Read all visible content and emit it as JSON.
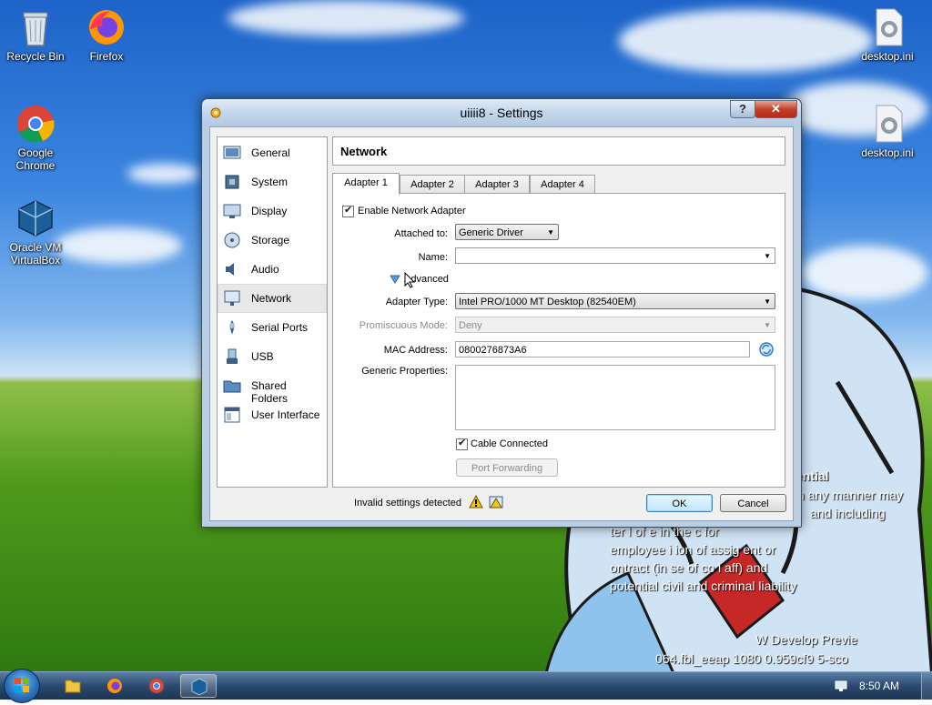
{
  "desktop": {
    "icons": [
      {
        "label": "Recycle Bin"
      },
      {
        "label": "Firefox"
      },
      {
        "label": "Google Chrome"
      },
      {
        "label": "Oracle VM VirtualBox"
      },
      {
        "label": "desktop.ini"
      },
      {
        "label": "desktop.ini"
      }
    ],
    "watermark_lines": [
      "ential",
      "n any manner may",
      "and including",
      "ter l    of e        in the c  for",
      "employee    i   ion of assig  ent or",
      "ontract (in     se of co   l   aff) and",
      "potential civil and criminal liability",
      "W    Develop     Previe",
      "064.fbl_eeap     1080    0.959cf9     5-sco"
    ]
  },
  "dialog": {
    "title": "uiiii8 - Settings",
    "help_glyph": "?",
    "close_glyph": "✕",
    "sidebar": [
      {
        "label": "General",
        "icon": "general-icon"
      },
      {
        "label": "System",
        "icon": "system-icon"
      },
      {
        "label": "Display",
        "icon": "display-icon"
      },
      {
        "label": "Storage",
        "icon": "storage-icon"
      },
      {
        "label": "Audio",
        "icon": "audio-icon"
      },
      {
        "label": "Network",
        "icon": "network-icon",
        "selected": true
      },
      {
        "label": "Serial Ports",
        "icon": "serial-ports-icon"
      },
      {
        "label": "USB",
        "icon": "usb-icon"
      },
      {
        "label": "Shared Folders",
        "icon": "shared-folders-icon"
      },
      {
        "label": "User Interface",
        "icon": "user-interface-icon"
      }
    ],
    "section_title": "Network",
    "tabs": [
      "Adapter 1",
      "Adapter 2",
      "Adapter 3",
      "Adapter 4"
    ],
    "active_tab": "Adapter 1",
    "adapter": {
      "enable_label": "Enable Network Adapter",
      "enable_checked": true,
      "attached_label": "Attached to:",
      "attached_value": "Generic Driver",
      "name_label": "Name:",
      "name_value": "",
      "advanced_label": "Advanced",
      "adapter_type_label": "Adapter Type:",
      "adapter_type_value": "Intel PRO/1000 MT Desktop (82540EM)",
      "promiscuous_label": "Promiscuous Mode:",
      "promiscuous_value": "Deny",
      "mac_label": "MAC Address:",
      "mac_value": "0800276873A6",
      "generic_props_label": "Generic Properties:",
      "generic_props_value": "",
      "cable_label": "Cable Connected",
      "cable_checked": true,
      "port_forwarding_label": "Port Forwarding"
    },
    "footer": {
      "invalid_text": "Invalid settings detected",
      "ok_label": "OK",
      "cancel_label": "Cancel"
    }
  },
  "taskbar": {
    "items": [
      "file-explorer",
      "firefox",
      "chrome",
      "virtualbox"
    ],
    "clock": "8:50 AM"
  },
  "colors": {
    "sky": "#2f78d6",
    "grass": "#4f9a1c",
    "dialog_frame": "#b9cde3",
    "close_red": "#c3412a"
  }
}
